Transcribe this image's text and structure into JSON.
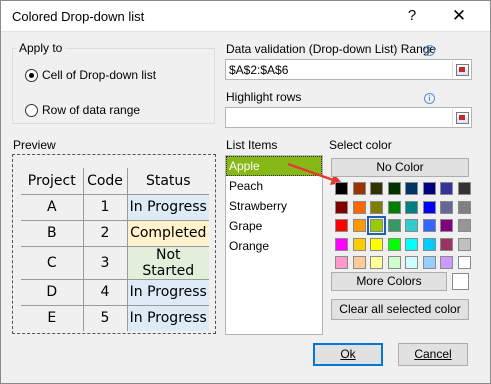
{
  "window": {
    "title": "Colored Drop-down list",
    "help": "?",
    "close": "✕"
  },
  "apply_to": {
    "label": "Apply to",
    "options": [
      {
        "label": "Cell of Drop-down list",
        "checked": true
      },
      {
        "label": "Row of data range",
        "checked": false
      }
    ]
  },
  "data_validation": {
    "label": "Data validation (Drop-down List) Range",
    "value": "$A$2:$A$6",
    "placeholder": ""
  },
  "highlight_rows": {
    "label": "Highlight rows",
    "value": "",
    "placeholder": ""
  },
  "preview": {
    "label": "Preview",
    "headers": [
      "Project",
      "Code",
      "Status"
    ],
    "rows": [
      {
        "project": "A",
        "code": "1",
        "status": "In Progress",
        "color": "#ddebf7"
      },
      {
        "project": "B",
        "code": "2",
        "status": "Completed",
        "color": "#fff2cc"
      },
      {
        "project": "C",
        "code": "3",
        "status": "Not Started",
        "color": "#e2efda"
      },
      {
        "project": "D",
        "code": "4",
        "status": "In Progress",
        "color": "#ddebf7"
      },
      {
        "project": "E",
        "code": "5",
        "status": "In Progress",
        "color": "#ddebf7"
      }
    ]
  },
  "list_items": {
    "label": "List Items",
    "items": [
      "Apple",
      "Peach",
      "Strawberry",
      "Grape",
      "Orange"
    ],
    "selected_index": 0,
    "selected_color": "#86b817"
  },
  "select_color": {
    "label": "Select color",
    "no_color": "No Color",
    "more_colors": "More Colors",
    "clear_all": "Clear all selected color",
    "palette": [
      [
        "#000000",
        "#993300",
        "#333300",
        "#003300",
        "#003366",
        "#000080",
        "#333399",
        "#333333"
      ],
      [
        "#800000",
        "#ff6600",
        "#808000",
        "#008000",
        "#008080",
        "#0000ff",
        "#666699",
        "#808080"
      ],
      [
        "#ff0000",
        "#ff9900",
        "#99cc00",
        "#339966",
        "#33cccc",
        "#3366ff",
        "#800080",
        "#969696"
      ],
      [
        "#ff00ff",
        "#ffcc00",
        "#ffff00",
        "#00ff00",
        "#00ffff",
        "#00ccff",
        "#993366",
        "#c0c0c0"
      ],
      [
        "#ff99cc",
        "#ffcc99",
        "#ffff99",
        "#ccffcc",
        "#ccffff",
        "#99ccff",
        "#cc99ff",
        "#ffffff"
      ]
    ],
    "selected": {
      "row": 2,
      "col": 2
    }
  },
  "footer": {
    "ok": "Ok",
    "cancel": "Cancel"
  },
  "colors": {
    "arrow": "#e53935",
    "accent": "#0078d7"
  }
}
